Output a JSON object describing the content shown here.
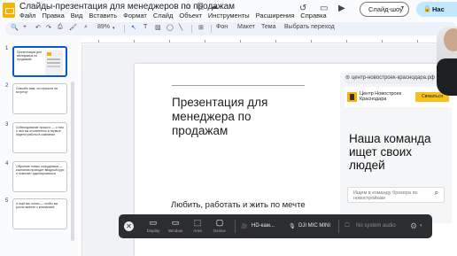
{
  "header": {
    "doc_title": "Слайды-презентация для менеджеров по продажам",
    "title_icons": [
      "☆",
      "⎘",
      "☁"
    ],
    "menu": [
      "Файл",
      "Правка",
      "Вид",
      "Вставить",
      "Формат",
      "Слайд",
      "Объект",
      "Инструменты",
      "Расширения",
      "Справка"
    ],
    "history_icon": "↺",
    "comment_icon": "▭",
    "meet_icon": "▶",
    "slideshow_label": "Слайд-шоу",
    "slideshow_caret": "▾",
    "share_label": "Нас",
    "share_icon": "🔒"
  },
  "toolbar": {
    "search": "🔍",
    "add": "+",
    "undo": "↶",
    "redo": "↷",
    "print": "⎙",
    "paint": "🖌",
    "zoom_icon": "⌕",
    "zoom": "89%",
    "zoom_caret": "▾",
    "select": "↖",
    "textbox": "T",
    "image": "▨",
    "shape": "◯",
    "line": "╲",
    "comment": "⊞",
    "background": "Фон",
    "layout": "Макет",
    "theme": "Тема",
    "transition": "Выбрать переход"
  },
  "slides": [
    {
      "num": "1",
      "text": "Презентация для менеджера по продажам",
      "active": true
    },
    {
      "num": "2",
      "text": "Спасибо вам, что пришли на встречу!",
      "active": false
    },
    {
      "num": "3",
      "text": "Собеседование прошло — о том, с чем вы столкнетесь в первые недели работы в компании",
      "active": false
    },
    {
      "num": "4",
      "text": "Обучение новых сотрудников — компания проводит вводный курс и помогает адаптироваться",
      "active": false
    },
    {
      "num": "5",
      "text": "А ещё мы хотим — чтобы вы росли вместе с компанией",
      "active": false
    }
  ],
  "slide": {
    "title": "Презентация для менеджера по продажам",
    "subtitle": "Любить, работать и жить по мечте"
  },
  "site": {
    "url": "центр-новостроек-краснодара.рф",
    "brand": "Центр Новостроек Краснодара",
    "contact": "Связаться",
    "heading": "Наша команда ищет своих людей",
    "search_placeholder": "Ищем в команду брокера по новостройкам"
  },
  "recorder": {
    "close": "✕",
    "items": [
      {
        "icon": "▭",
        "label": "Display"
      },
      {
        "icon": "▭",
        "label": "Window"
      },
      {
        "icon": "⬚",
        "label": "Area"
      },
      {
        "icon": "▢",
        "label": "Device"
      }
    ],
    "camera": "HD-кам...",
    "camera_icon": "🎥",
    "mic": "DJI MIC MINI",
    "mic_icon": "🎙",
    "system_audio": "No system audio",
    "system_icon": "🖵",
    "settings_icon": "⚙",
    "settings_caret": "▾"
  }
}
